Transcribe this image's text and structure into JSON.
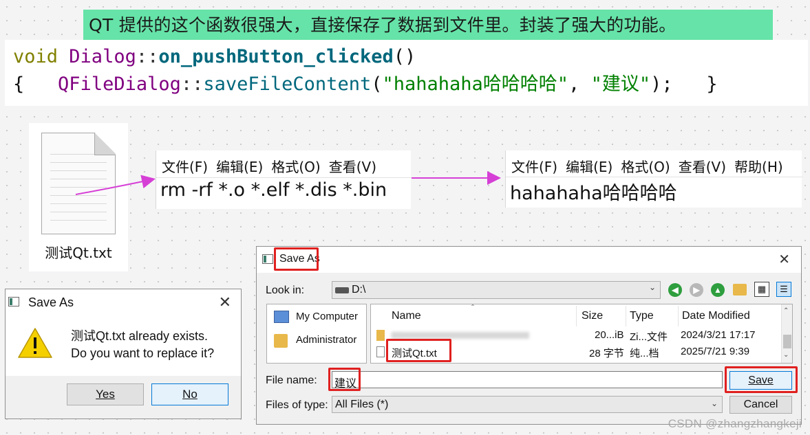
{
  "banner": "QT 提供的这个函数很强大，直接保存了数据到文件里。封装了强大的功能。",
  "code": {
    "l1_void": "void",
    "l1_class": "Dialog",
    "l1_sep": "::",
    "l1_func": "on_pushButton_clicked",
    "l1_paren": "()",
    "l2_open": "{",
    "l2_class": "QFileDialog",
    "l2_sep": "::",
    "l2_func": "saveFileContent",
    "l2_lp": "(",
    "l2_str1": "\"hahahaha哈哈哈哈\"",
    "l2_comma": ",",
    "l2_str2": "\"建议\"",
    "l2_rp": ");",
    "l2_close": "}"
  },
  "file_icon": {
    "label": "测试Qt.txt"
  },
  "notepad_before": {
    "menu": [
      "文件(F)",
      "编辑(E)",
      "格式(O)",
      "查看(V)"
    ],
    "content": "rm -rf *.o *.elf *.dis *.bin"
  },
  "notepad_after": {
    "menu": [
      "文件(F)",
      "编辑(E)",
      "格式(O)",
      "查看(V)",
      "帮助(H)"
    ],
    "content": "hahahaha哈哈哈哈"
  },
  "confirm_dialog": {
    "title": "Save As",
    "message_line1": "测试Qt.txt already exists.",
    "message_line2": "Do you want to replace it?",
    "yes_label": "Yes",
    "no_label": "No"
  },
  "save_dialog": {
    "title": "Save As",
    "look_in_label": "Look in:",
    "look_in_value": "D:\\",
    "sidebar": [
      "My Computer",
      "Administrator"
    ],
    "columns": [
      "Name",
      "Size",
      "Type",
      "Date Modified"
    ],
    "rows": [
      {
        "name": "—",
        "size": "20...iB",
        "type": "Zi...文件",
        "date": "2024/3/21 17:17"
      },
      {
        "name": "测试Qt.txt",
        "size": "28 字节",
        "type": "纯...档",
        "date": "2025/7/21 9:39"
      }
    ],
    "file_name_label": "File name:",
    "file_name_value": "建议",
    "file_type_label": "Files of type:",
    "file_type_value": "All Files (*)",
    "save_label": "Save",
    "cancel_label": "Cancel"
  },
  "watermark": "CSDN @zhangzhangkeji",
  "colors": {
    "banner": "#66e3a8",
    "highlight_box": "#e02020",
    "arrow": "#d63fd6"
  }
}
